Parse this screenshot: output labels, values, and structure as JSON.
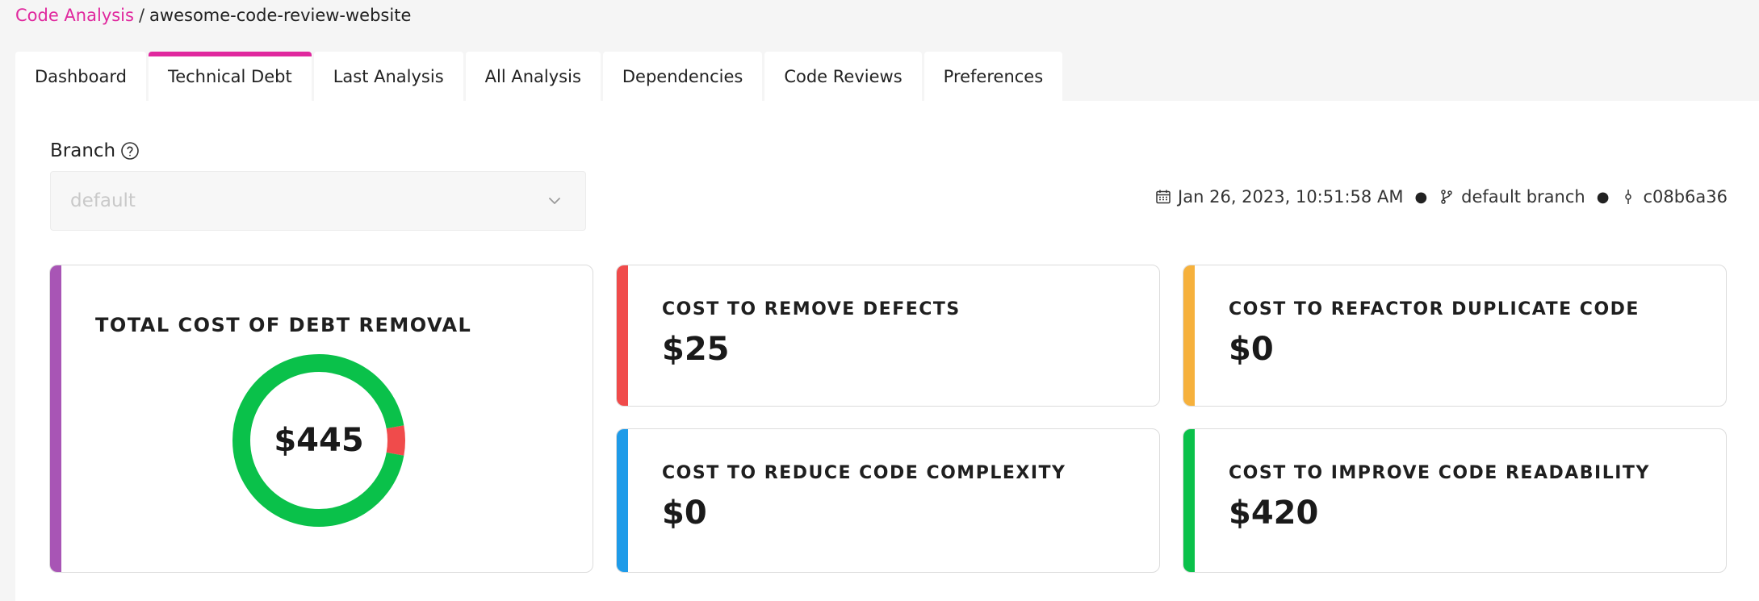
{
  "breadcrumb": {
    "root": "Code Analysis",
    "separator": "/",
    "current": "awesome-code-review-website"
  },
  "tabs": [
    {
      "label": "Dashboard",
      "active": false
    },
    {
      "label": "Technical Debt",
      "active": true
    },
    {
      "label": "Last Analysis",
      "active": false
    },
    {
      "label": "All Analysis",
      "active": false
    },
    {
      "label": "Dependencies",
      "active": false
    },
    {
      "label": "Code Reviews",
      "active": false
    },
    {
      "label": "Preferences",
      "active": false
    }
  ],
  "branch": {
    "label": "Branch",
    "help_icon": "question-circle-icon",
    "selected": "default"
  },
  "meta": {
    "timestamp": "Jan 26, 2023, 10:51:58 AM",
    "branch": "default branch",
    "commit": "c08b6a36"
  },
  "colors": {
    "accent": "#e0289e",
    "total": "#a855b5",
    "defects": "#f04b4b",
    "duplicate": "#f6b13c",
    "complexity": "#1e9be9",
    "readability": "#0ac14a"
  },
  "cards": {
    "total": {
      "title": "TOTAL COST OF DEBT REMOVAL",
      "value": "$445"
    },
    "defects": {
      "title": "COST TO REMOVE DEFECTS",
      "value": "$25"
    },
    "duplicate": {
      "title": "COST TO REFACTOR DUPLICATE CODE",
      "value": "$0"
    },
    "complexity": {
      "title": "COST TO REDUCE CODE COMPLEXITY",
      "value": "$0"
    },
    "readability": {
      "title": "COST TO IMPROVE CODE READABILITY",
      "value": "$420"
    }
  },
  "chart_data": {
    "type": "pie",
    "donut": true,
    "center_label": "$445",
    "slices": [
      {
        "category": "defects",
        "value": 25,
        "color": "#f04b4b"
      },
      {
        "category": "duplicate",
        "value": 0,
        "color": "#f6b13c"
      },
      {
        "category": "complexity",
        "value": 0,
        "color": "#1e9be9"
      },
      {
        "category": "readability",
        "value": 420,
        "color": "#0ac14a"
      }
    ]
  }
}
